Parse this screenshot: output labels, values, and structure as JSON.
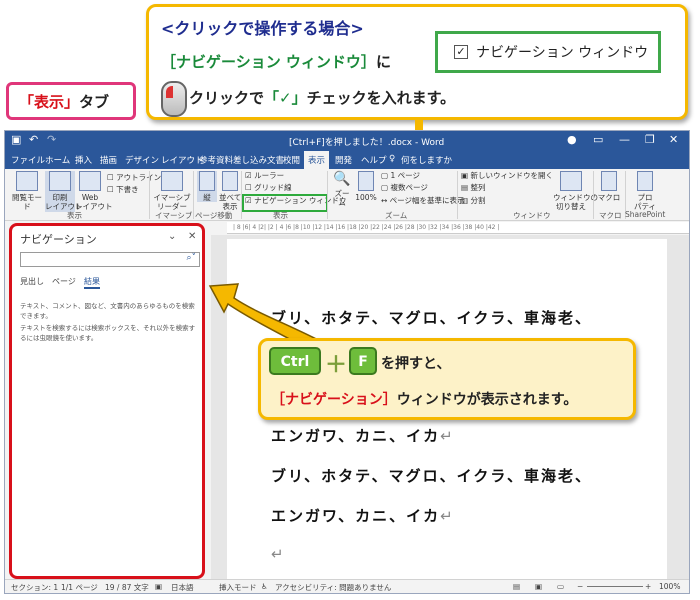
{
  "callout": {
    "line1": "<クリックで操作する場合>",
    "line2_green": "［ナビゲーション ウィンドウ］",
    "line2_suffix": "に",
    "line3_pre": "クリックで",
    "line3_check": "「✓」",
    "line3_post": "チェックを入れます。",
    "navbox_label": "ナビゲーション ウィンドウ",
    "navbox_check": "✓"
  },
  "tab_callout": {
    "red": "「表示」",
    "suffix": "タブ"
  },
  "window": {
    "title": "[Ctrl+F]を押しました！.docx - Word",
    "undo": "↶",
    "redo": "↷",
    "user": "●",
    "minimize": "—",
    "restore": "❐",
    "close": "✕"
  },
  "tabs": [
    "ファイル",
    "ホーム",
    "挿入",
    "描画",
    "デザイン",
    "レイアウト",
    "参考資料",
    "差し込み文書",
    "校閲",
    "表示",
    "開発",
    "ヘルプ",
    "何をしますか"
  ],
  "ribbon": {
    "read_mode": "閲覧モード",
    "print_layout": "印刷\nレイアウト",
    "web_layout": "Web\nレイアウト",
    "outline": "アウトライン",
    "draft": "下書き",
    "group_view": "表示",
    "immersive_reader": "イマーシブ\nリーダー",
    "group_immersive": "イマーシブ",
    "vertical": "縦",
    "side_by_side": "並べて\n表示",
    "group_page_move": "ページ移動",
    "ruler": "ルーラー",
    "gridlines": "グリッド線",
    "nav_pane": "ナビゲーション ウィンドウ",
    "group_show": "表示",
    "zoom": "ズーム",
    "zoom_100": "100%",
    "one_page": "1 ページ",
    "multiple_pages": "複数ページ",
    "page_width": "ページ幅を基準に表示",
    "group_zoom": "ズーム",
    "new_window": "新しいウィンドウを開く",
    "arrange_all": "整列",
    "split": "分割",
    "group_window": "ウィンドウ",
    "switch_windows": "ウィンドウの\n切り替え",
    "macro": "マクロ",
    "group_macro": "マクロ",
    "properties": "プロ\nパティ",
    "group_sharepoint": "SharePoint"
  },
  "ruler_text": "| 8 |6| 4 |2| |2 | 4 |6 |8 |10 |12 |14 |16 |18 |20 |22 |24 |26 |28 |30 |32 |34 |36 |38 |40 |42 |",
  "nav_pane": {
    "title": "ナビゲーション",
    "search_placeholder": "",
    "tabs": [
      "見出し",
      "ページ",
      "結果"
    ],
    "text1": "テキスト、コメント、図など、文書内のあらゆるものを検索できます。",
    "text2": "テキストを検索するには検索ボックスを、それ以外を検索するには虫眼鏡を使います。"
  },
  "document": {
    "line1": "ブリ、ホタテ、マグロ、イクラ、車海老、",
    "line2": "エンガワ、カニ、イカ",
    "line3": "ブリ、ホタテ、マグロ、イクラ、車海老、",
    "line4": "エンガワ、カニ、イカ",
    "return_mark": "↵"
  },
  "ctrl_callout": {
    "key_ctrl": "Ctrl",
    "plus": "＋",
    "key_f": "F",
    "text1": "を押すと、",
    "text2_red": "［ナビゲーション］",
    "text2_post": "ウィンドウが表示されます。"
  },
  "status": {
    "section": "セクション: 1",
    "page": "1/1 ページ",
    "words_count": "19 / 87 文字",
    "language": "日本語",
    "insert_mode": "挿入モード",
    "accessibility": "アクセシビリティ: 問題ありません",
    "zoom": "100%"
  },
  "colors": {
    "word_blue": "#2b579a",
    "callout_border": "#f5b800",
    "highlight_red": "#d8101a",
    "highlight_green": "#2eaa3c"
  }
}
